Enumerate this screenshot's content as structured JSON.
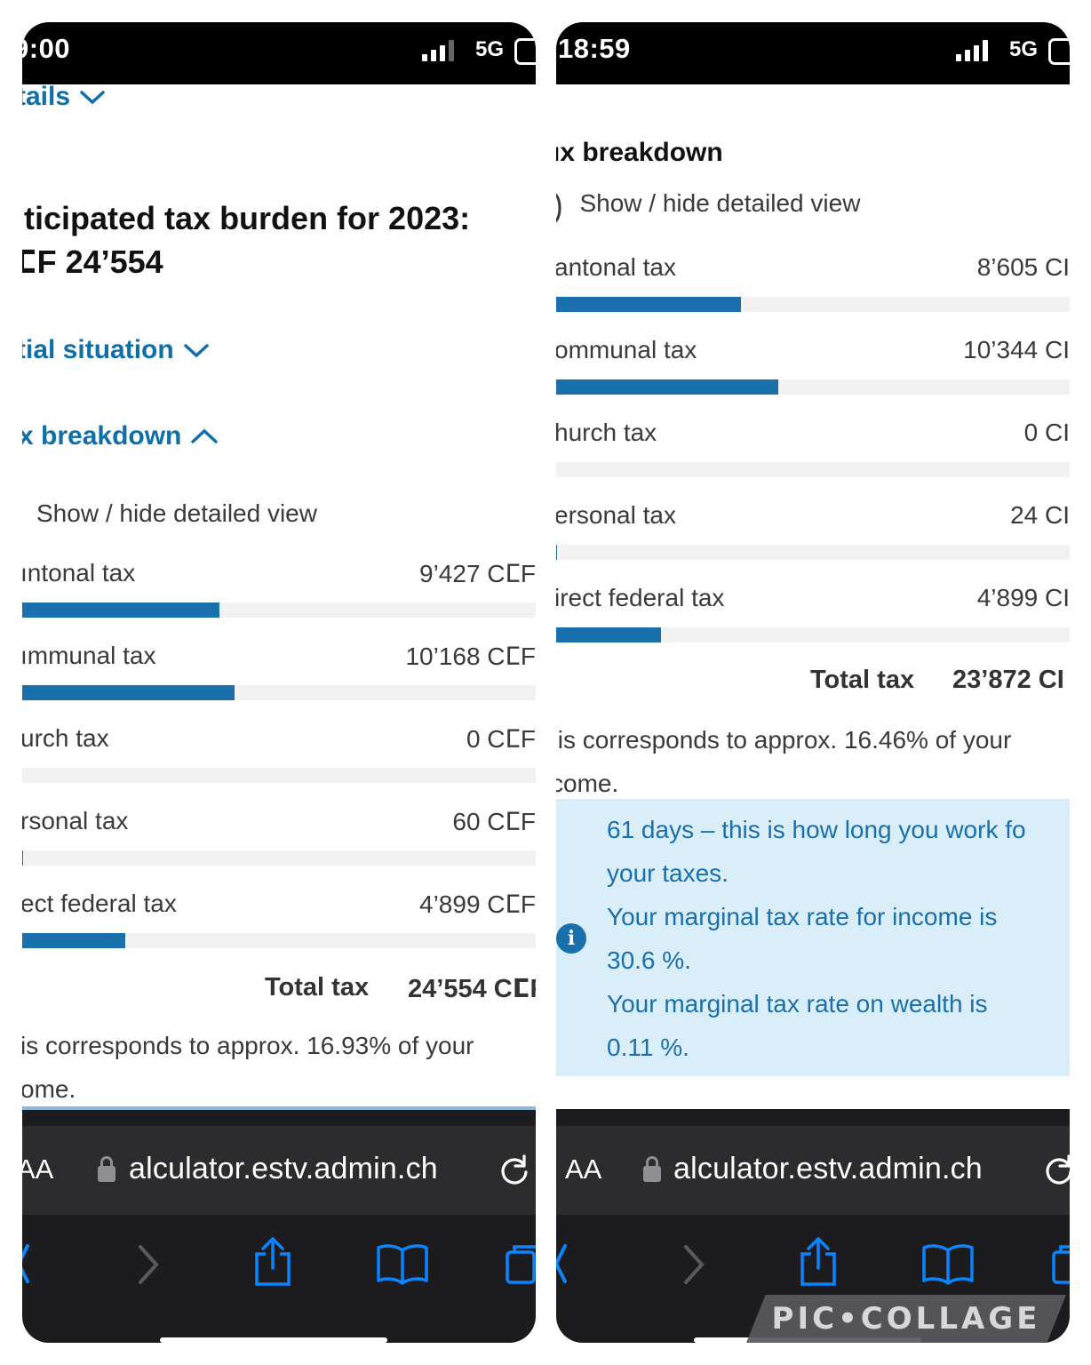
{
  "left": {
    "status": {
      "time": "9:00",
      "network": "5G"
    },
    "details_link": "tails",
    "headline_line1": "ıticipated tax burden for 2023:",
    "headline_line2": "ⵎF 24’554",
    "situation_link": "tial situation",
    "breakdown_link": "x breakdown",
    "toggle_text": "Show / hide detailed view",
    "rows": [
      {
        "label": "ıntonal tax",
        "value": "9’427 CⵎF",
        "share": 0.384
      },
      {
        "label": "ımmunal tax",
        "value": "10’168 CⵎF",
        "share": 0.414
      },
      {
        "label": "urch tax",
        "value": "0 CⵎF",
        "share": 0
      },
      {
        "label": "rsonal tax",
        "value": "60 CⵎF",
        "share": 0.002
      },
      {
        "label": "ect federal tax",
        "value": "4’899 CⵎF",
        "share": 0.2
      }
    ],
    "total_label": "Total tax",
    "total_value": "24’554 CⵎF",
    "corresponds_line1": "is corresponds to approx. 16.93% of your",
    "corresponds_line2": "ome.",
    "url": "alculator.estv.admin.ch",
    "aa_label": "AA"
  },
  "right": {
    "status": {
      "time": "18:59",
      "network": "5G"
    },
    "section_title": "ıx breakdown",
    "toggle_text": "Show / hide detailed view",
    "rows": [
      {
        "label": "antonal tax",
        "value": "8’605 CI",
        "share": 0.36
      },
      {
        "label": "ommunal tax",
        "value": "10’344 CI",
        "share": 0.433
      },
      {
        "label": "hurch tax",
        "value": "0 CI",
        "share": 0
      },
      {
        "label": "ersonal tax",
        "value": "24 CI",
        "share": 0.001
      },
      {
        "label": "irect federal tax",
        "value": "4’899 CI",
        "share": 0.205
      }
    ],
    "total_label": "Total tax",
    "total_value": "23’872 CI",
    "corresponds_line1": "ıis corresponds to approx. 16.46% of your",
    "corresponds_line2": "come.",
    "info": {
      "line1": "61 days – this is how long you work fo",
      "line2": "your taxes.",
      "line3": "Your marginal tax rate for income is",
      "line4": "30.6 %.",
      "line5": "Your marginal tax rate on wealth is",
      "line6": "0.11 %."
    },
    "url": "alculator.estv.admin.ch",
    "aa_label": "AA"
  },
  "watermark": "PIC•COLLAGE",
  "colors": {
    "accent": "#1a6fad",
    "info_bg": "#d9eef8",
    "bar_track": "#f2f2f2"
  }
}
